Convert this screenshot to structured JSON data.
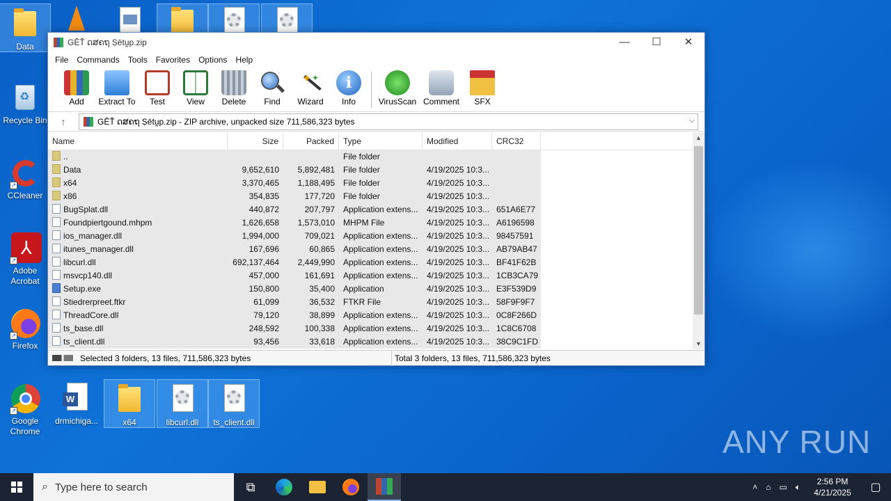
{
  "desktop": {
    "icons": [
      {
        "label": "Data"
      },
      {
        "label": "Recycle Bin"
      },
      {
        "label": "CCleaner"
      },
      {
        "label": "Adobe Acrobat"
      },
      {
        "label": "Firefox"
      },
      {
        "label": "Google Chrome"
      },
      {
        "label": "drmichiga..."
      },
      {
        "label": "x64"
      },
      {
        "label": "libcurl.dll"
      },
      {
        "label": "ts_client.dll"
      }
    ],
    "watermark": "ANY RUN"
  },
  "window": {
    "title": "GĒŤ ດສຄຖ Ṣētṵp.zip",
    "menu": [
      "File",
      "Commands",
      "Tools",
      "Favorites",
      "Options",
      "Help"
    ],
    "toolbar": [
      "Add",
      "Extract To",
      "Test",
      "View",
      "Delete",
      "Find",
      "Wizard",
      "Info",
      "VirusScan",
      "Comment",
      "SFX"
    ],
    "address": "GĒŤ ດສຄຖ Ṣētṵp.zip - ZIP archive, unpacked size 711,586,323 bytes",
    "columns": [
      "Name",
      "Size",
      "Packed",
      "Type",
      "Modified",
      "CRC32"
    ],
    "rows": [
      {
        "name": "..",
        "size": "",
        "packed": "",
        "type": "File folder",
        "modified": "",
        "crc": "",
        "icon": "fold"
      },
      {
        "name": "Data",
        "size": "9,652,610",
        "packed": "5,892,481",
        "type": "File folder",
        "modified": "4/19/2025 10:3...",
        "crc": "",
        "icon": "fold"
      },
      {
        "name": "x64",
        "size": "3,370,465",
        "packed": "1,188,495",
        "type": "File folder",
        "modified": "4/19/2025 10:3...",
        "crc": "",
        "icon": "fold"
      },
      {
        "name": "x86",
        "size": "354,835",
        "packed": "177,720",
        "type": "File folder",
        "modified": "4/19/2025 10:3...",
        "crc": "",
        "icon": "fold"
      },
      {
        "name": "BugSplat.dll",
        "size": "440,872",
        "packed": "207,797",
        "type": "Application extens...",
        "modified": "4/19/2025 10:3...",
        "crc": "651A6E77",
        "icon": "dll"
      },
      {
        "name": "Foundpiertgound.mhpm",
        "size": "1,626,658",
        "packed": "1,573,010",
        "type": "MHPM File",
        "modified": "4/19/2025 10:3...",
        "crc": "A6196598",
        "icon": "file"
      },
      {
        "name": "ios_manager.dll",
        "size": "1,994,000",
        "packed": "709,021",
        "type": "Application extens...",
        "modified": "4/19/2025 10:3...",
        "crc": "98457591",
        "icon": "dll"
      },
      {
        "name": "itunes_manager.dll",
        "size": "167,696",
        "packed": "60,865",
        "type": "Application extens...",
        "modified": "4/19/2025 10:3...",
        "crc": "AB79AB47",
        "icon": "dll"
      },
      {
        "name": "libcurl.dll",
        "size": "692,137,464",
        "packed": "2,449,990",
        "type": "Application extens...",
        "modified": "4/19/2025 10:3...",
        "crc": "BF41F62B",
        "icon": "dll"
      },
      {
        "name": "msvcp140.dll",
        "size": "457,000",
        "packed": "161,691",
        "type": "Application extens...",
        "modified": "4/19/2025 10:3...",
        "crc": "1CB3CA79",
        "icon": "dll"
      },
      {
        "name": "Setup.exe",
        "size": "150,800",
        "packed": "35,400",
        "type": "Application",
        "modified": "4/19/2025 10:3...",
        "crc": "E3F539D9",
        "icon": "exe"
      },
      {
        "name": "Stiedrerpreet.ftkr",
        "size": "61,099",
        "packed": "36,532",
        "type": "FTKR File",
        "modified": "4/19/2025 10:3...",
        "crc": "58F9F9F7",
        "icon": "file"
      },
      {
        "name": "ThreadCore.dll",
        "size": "79,120",
        "packed": "38,899",
        "type": "Application extens...",
        "modified": "4/19/2025 10:3...",
        "crc": "0C8F266D",
        "icon": "dll"
      },
      {
        "name": "ts_base.dll",
        "size": "248,592",
        "packed": "100,338",
        "type": "Application extens...",
        "modified": "4/19/2025 10:3...",
        "crc": "1C8C6708",
        "icon": "dll"
      },
      {
        "name": "ts_client.dll",
        "size": "93,456",
        "packed": "33,618",
        "type": "Application extens...",
        "modified": "4/19/2025 10:3...",
        "crc": "38C9C1FD",
        "icon": "dll"
      }
    ],
    "status_left": "Selected 3 folders, 13 files, 711,586,323 bytes",
    "status_right": "Total 3 folders, 13 files, 711,586,323 bytes"
  },
  "taskbar": {
    "search_placeholder": "Type here to search",
    "time": "2:56 PM",
    "date": "4/21/2025"
  },
  "colors": {
    "desktop": "#0b63c7",
    "taskbar": "#1c2433",
    "selection": "#e8e8e8"
  }
}
